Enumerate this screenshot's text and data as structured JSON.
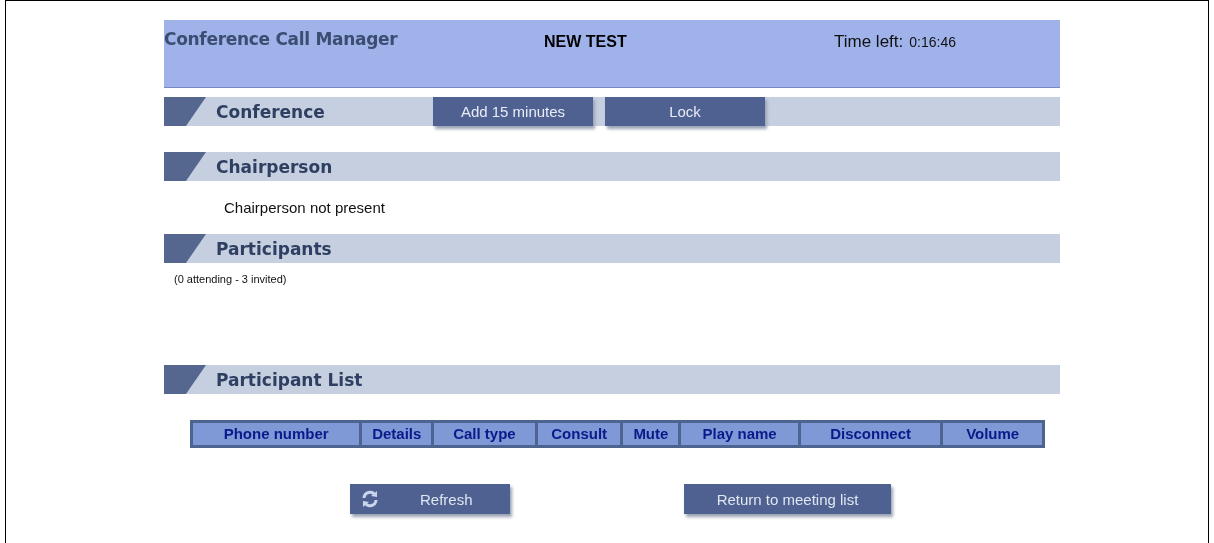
{
  "header": {
    "title": "Conference Call Manager",
    "conference_name": "NEW TEST",
    "time_label": "Time left:",
    "time_value": "0:16:46"
  },
  "sections": [
    {
      "kind": "conference",
      "title": "Conference",
      "buttons": [
        "Add 15 minutes",
        "Lock"
      ]
    },
    {
      "kind": "chairperson",
      "title": "Chairperson",
      "text": "Chairperson not present"
    },
    {
      "kind": "participants",
      "title": "Participants",
      "text": "(0 attending - 3 invited)"
    },
    {
      "kind": "list",
      "title": "Participant List",
      "columns": [
        "Phone number",
        "Details",
        "Call type",
        "Consult",
        "Mute",
        "Play name",
        "Disconnect",
        "Volume"
      ]
    }
  ],
  "footer_buttons": [
    {
      "kind": "refresh",
      "label": "Refresh"
    },
    {
      "kind": "plain",
      "label": "Return to meeting list"
    }
  ]
}
